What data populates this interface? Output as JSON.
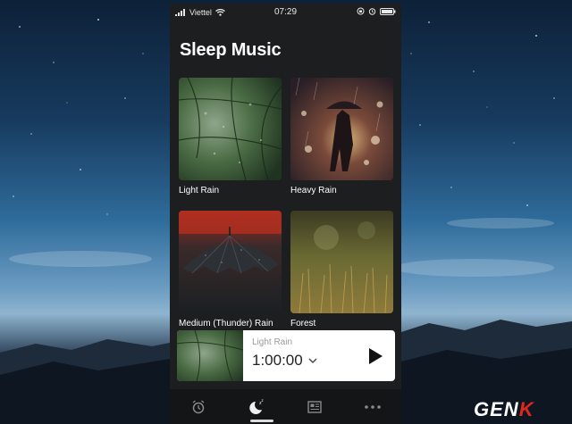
{
  "status_bar": {
    "carrier": "Viettel",
    "time": "07:29"
  },
  "screen_title": "Sleep Music",
  "sounds": [
    {
      "label": "Light Rain"
    },
    {
      "label": "Heavy Rain"
    },
    {
      "label": "Medium (Thunder) Rain"
    },
    {
      "label": "Forest"
    }
  ],
  "now_playing": {
    "track": "Light Rain",
    "timer": "1:00:00"
  },
  "tabs": [
    {
      "icon": "alarm-clock-icon"
    },
    {
      "icon": "sleep-moon-icon"
    },
    {
      "icon": "news-icon"
    },
    {
      "icon": "more-icon"
    }
  ],
  "watermark": {
    "text": "GEN",
    "accent": "K"
  },
  "colors": {
    "screen_background": "#1c1e1f",
    "tab_bar": "#141516",
    "accent_red": "#e0271d"
  }
}
